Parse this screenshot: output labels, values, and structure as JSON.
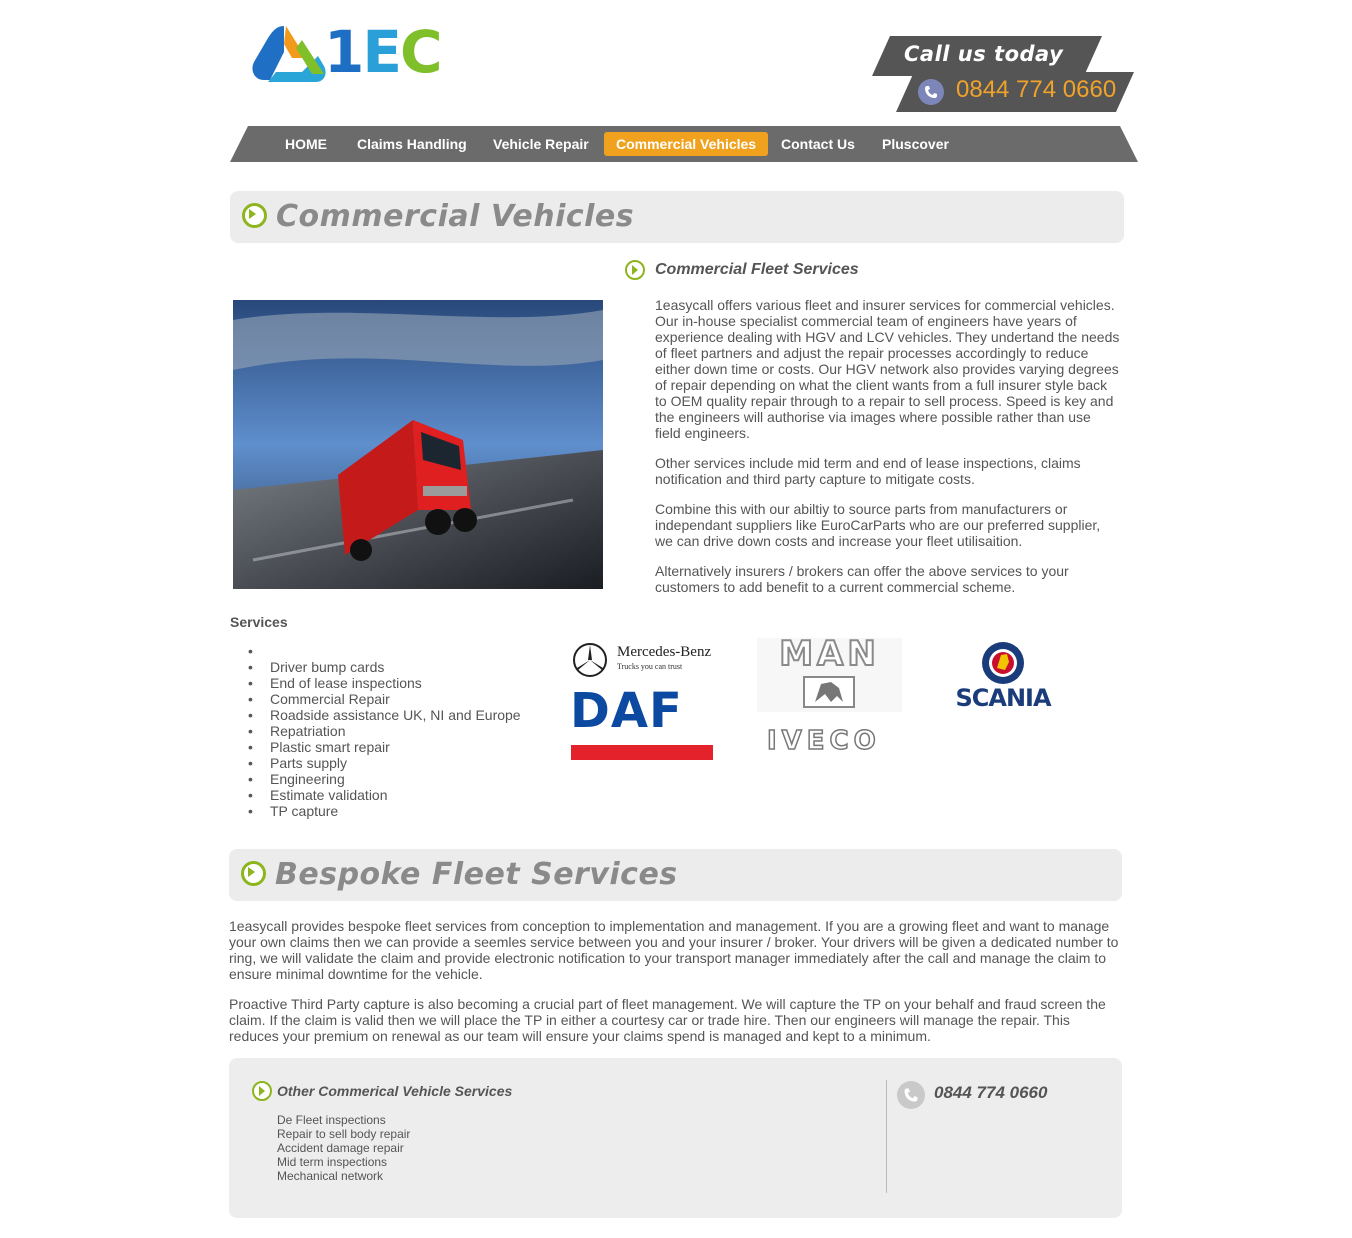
{
  "header": {
    "logo_text_1": "1",
    "logo_text_e": "E",
    "logo_text_c": "C",
    "call_label": "Call us today",
    "phone": "0844 774 0660"
  },
  "nav": {
    "items": [
      {
        "label": "HOME",
        "active": false
      },
      {
        "label": "Claims Handling",
        "active": false
      },
      {
        "label": "Vehicle Repair",
        "active": false
      },
      {
        "label": "Commercial Vehicles",
        "active": true
      },
      {
        "label": "Contact Us",
        "active": false
      },
      {
        "label": "Pluscover",
        "active": false
      }
    ]
  },
  "section1": {
    "title": "Commercial Vehicles",
    "subtitle": "Commercial Fleet Services",
    "paragraphs": [
      "1easycall offers various fleet and insurer services for commercial vehicles. Our in-house specialist commercial team of engineers have years of experience dealing with HGV and LCV vehicles. They undertand the needs of fleet partners and adjust the repair processes accordingly to reduce either down time or costs. Our HGV network also provides varying degrees of repair depending on what the client wants from a full insurer style back to OEM quality repair through to a repair to sell process. Speed is key and the engineers will authorise via images where possible rather than use field engineers.",
      "Other services include mid term and end of lease inspections, claims notification and third party capture to mitigate costs.",
      "Combine this with our abiltiy to source parts from manufacturers or independant suppliers like EuroCarParts who are our preferred supplier, we can drive down costs and increase your fleet utilisaition.",
      "Alternatively insurers / brokers can offer the above services to your customers to add benefit to a current commercial scheme."
    ]
  },
  "services": {
    "heading": "Services",
    "items": [
      "",
      "Driver bump cards",
      "End of lease inspections",
      "Commercial Repair",
      "Roadside assistance UK, NI and Europe",
      "Repatriation",
      "Plastic smart repair",
      "Parts supply",
      "Engineering",
      "Estimate validation",
      "TP capture"
    ]
  },
  "brands": {
    "mercedes": "Mercedes-Benz",
    "mercedes_tag": "Trucks you can trust",
    "man": "MAN",
    "scania": "SCANIA",
    "daf": "DAF",
    "iveco": "IVECO"
  },
  "section2": {
    "title": "Bespoke Fleet Services",
    "paragraphs": [
      "1easycall provides bespoke fleet services from conception to implementation and management. If you are a growing fleet and want to manage your own claims then we can provide a seemles service between you and your insurer / broker. Your drivers will be given a dedicated number to ring, we will validate the claim and provide electronic notification to your transport manager immediately after the call and manage the claim to ensure minimal downtime for the vehicle.",
      "Proactive Third Party capture is also becoming a crucial part of fleet management. We will capture the TP on your behalf and fraud screen the claim. If the claim is valid then we will place the TP in either a courtesy car or trade hire. Then our engineers will manage the repair. This reduces your premium on renewal as our team will ensure your claims spend is managed and kept to a minimum."
    ]
  },
  "other": {
    "title": "Other Commerical Vehicle Services",
    "items": [
      "De Fleet inspections",
      "Repair to sell body repair",
      "Accident damage repair",
      "Mid term inspections",
      "Mechanical network"
    ],
    "phone": "0844 774 0660"
  },
  "colors": {
    "accent_orange": "#f0a21e",
    "nav_grey": "#6b6b6b",
    "green_icon": "#8cb51e"
  }
}
